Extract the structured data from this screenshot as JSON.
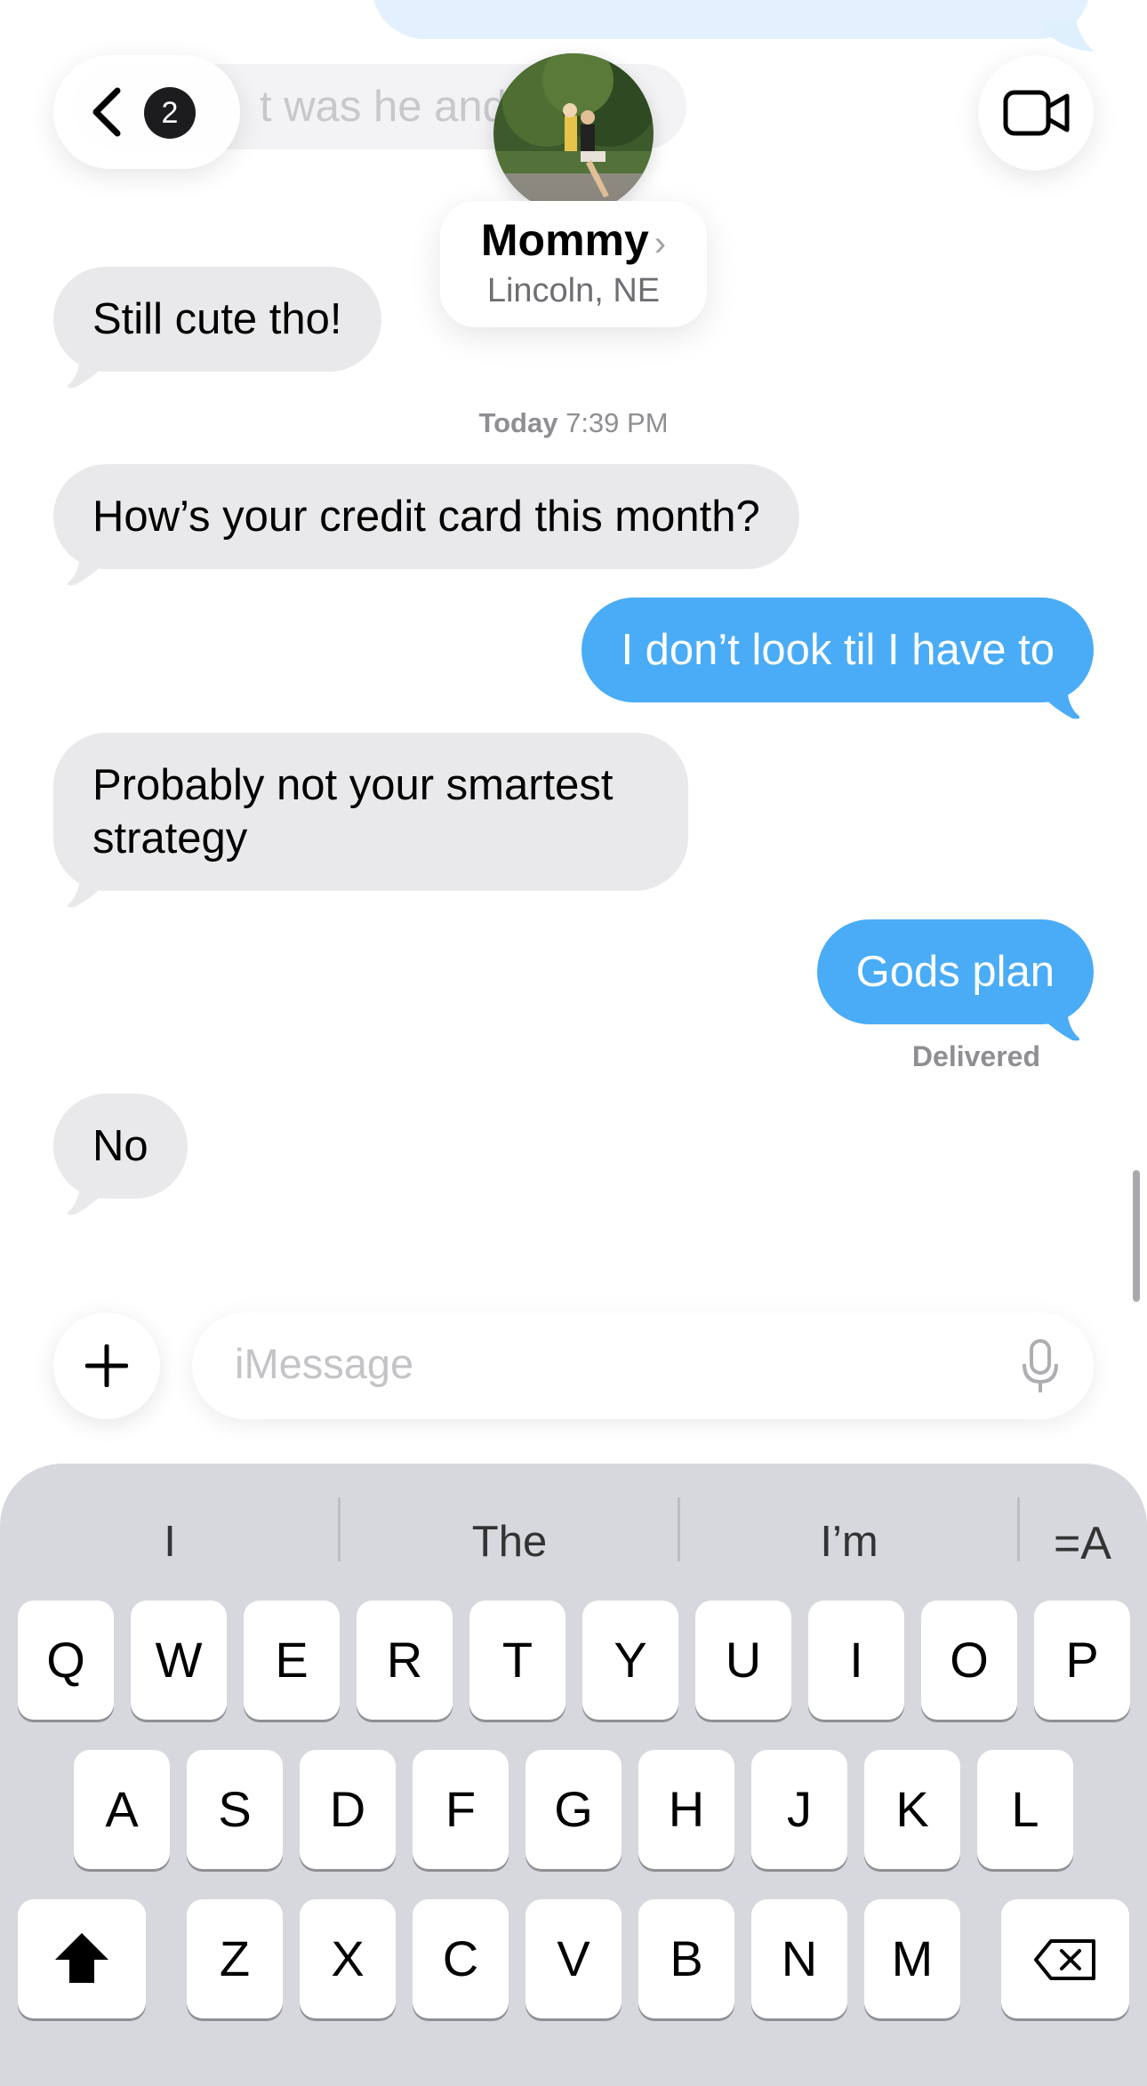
{
  "header": {
    "back_badge": "2",
    "contact_name": "Mommy",
    "contact_location": "Lincoln, NE"
  },
  "faded": {
    "incoming_partial": "t was he and"
  },
  "messages": [
    {
      "direction": "in",
      "text": "Still cute tho!"
    },
    {
      "direction": "in",
      "text": "How’s your credit card this month?"
    },
    {
      "direction": "out",
      "text": "I don’t look til I have to"
    },
    {
      "direction": "in",
      "text": "Probably not your smartest strategy"
    },
    {
      "direction": "out",
      "text": "Gods plan"
    },
    {
      "direction": "in",
      "text": "No"
    }
  ],
  "timestamp": {
    "day": "Today",
    "time": "7:39 PM"
  },
  "status": {
    "delivered": "Delivered"
  },
  "input": {
    "placeholder": "iMessage"
  },
  "keyboard": {
    "suggestions": [
      "I",
      "The",
      "I’m"
    ],
    "format_label": "=A",
    "row1": [
      "Q",
      "W",
      "E",
      "R",
      "T",
      "Y",
      "U",
      "I",
      "O",
      "P"
    ],
    "row2": [
      "A",
      "S",
      "D",
      "F",
      "G",
      "H",
      "J",
      "K",
      "L"
    ],
    "row3": [
      "Z",
      "X",
      "C",
      "V",
      "B",
      "N",
      "M"
    ]
  },
  "colors": {
    "outgoing_bubble": "#4aacf6",
    "incoming_bubble": "#e9e9eb",
    "keyboard_bg": "#d6d8dd"
  }
}
